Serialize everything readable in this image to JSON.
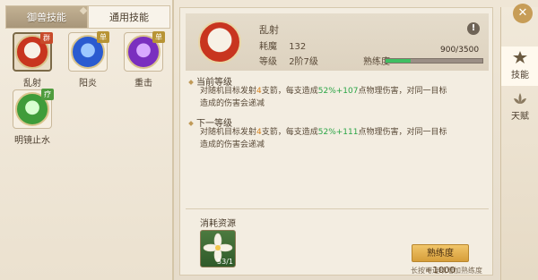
{
  "tabs": [
    {
      "label": "御兽技能",
      "active": true
    },
    {
      "label": "通用技能",
      "active": false
    }
  ],
  "skills": [
    {
      "name": "乱射",
      "badge": "群",
      "badge_color": "#c84a2a",
      "orb_color": "#c8351f",
      "selected": true
    },
    {
      "name": "阳炎",
      "badge": "单",
      "badge_color": "#b89435",
      "orb_color": "#2a5bd0",
      "selected": false
    },
    {
      "name": "重击",
      "badge": "单",
      "badge_color": "#b89435",
      "orb_color": "#7a2fbf",
      "selected": false
    },
    {
      "name": "明镜止水",
      "badge": "疗",
      "badge_color": "#4f9c3e",
      "orb_color": "#3f9c3a",
      "selected": false
    }
  ],
  "detail": {
    "title": "乱射",
    "cost_label": "耗魔",
    "cost_value": "132",
    "level_label": "等级",
    "level_value": "2阶7级",
    "proficiency_label": "熟练度",
    "proficiency_text": "900/3500",
    "proficiency_fraction": 0.257,
    "info_icon": "!"
  },
  "current_level": {
    "heading": "当前等级",
    "line1_a": "对随机目标发射",
    "line1_b": "4",
    "line1_c": "支箭，每支造成",
    "line1_d": "52%+107",
    "line1_e": "点物理伤害，对同一目标",
    "line2": "造成的伤害会递减"
  },
  "next_level": {
    "heading": "下一等级",
    "line1_a": "对随机目标发射",
    "line1_b": "4",
    "line1_c": "支箭，每支造成",
    "line1_d": "52%+111",
    "line1_e": "点物理伤害，对同一目标",
    "line2": "造成的伤害会递减"
  },
  "consume": {
    "heading": "消耗资源",
    "item_count": "53/1",
    "button_label": "熟练度+1000",
    "hint": "长按可连续增加熟练度"
  },
  "side_nav": [
    {
      "label": "技能",
      "active": true,
      "icon": "star-icon"
    },
    {
      "label": "天赋",
      "active": false,
      "icon": "lotus-icon"
    }
  ],
  "close_label": "✕",
  "colors": {
    "accent_green": "#2aa546",
    "accent_orange": "#d9821a",
    "tab_active": "#a8967a"
  }
}
